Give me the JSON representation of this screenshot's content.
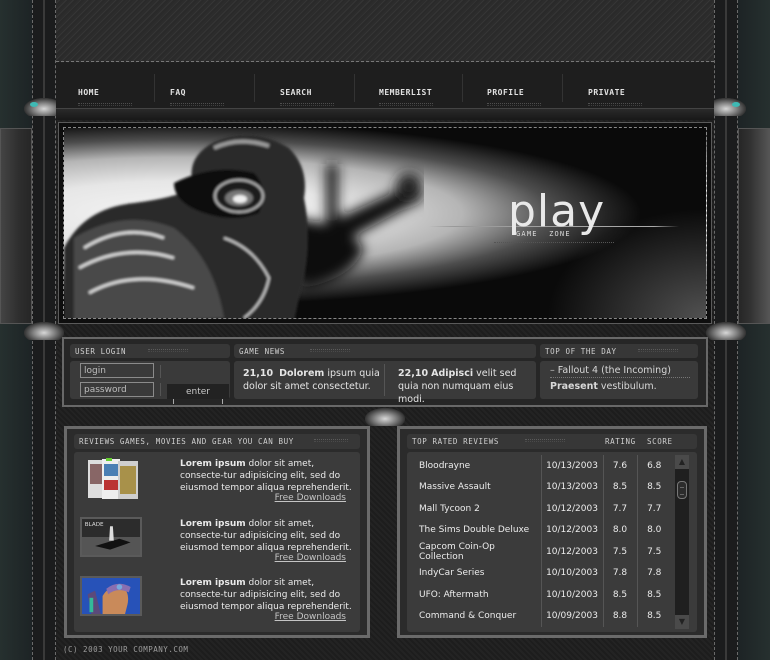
{
  "nav": {
    "items": [
      {
        "label": "Home"
      },
      {
        "label": "FAQ"
      },
      {
        "label": "Search"
      },
      {
        "label": "Memberlist"
      },
      {
        "label": "Profile"
      },
      {
        "label": "Private"
      }
    ]
  },
  "banner": {
    "title": "play",
    "subtitle": "GAME ZONE"
  },
  "login": {
    "heading": "User Login",
    "login_placeholder": "login",
    "password_placeholder": "password",
    "enter_label": "enter"
  },
  "news": {
    "heading": "Game News",
    "items": [
      {
        "date": "21,10",
        "bold": "Dolorem",
        "text": " ipsum quia dolor sit amet consectetur."
      },
      {
        "date": "22,10",
        "bold": "Adipisci",
        "text": " velit sed quia non numquam eius modi."
      }
    ]
  },
  "top_of_day": {
    "heading": "Top of the Day",
    "link": "Fallout 4  (the Incoming)",
    "bold": "Praesent",
    "text": " vestibulum."
  },
  "reviews": {
    "heading": "Reviews games, movies and gear you can buy",
    "items": [
      {
        "image": "game-boxes-thumbnail",
        "bold": "Lorem ipsum",
        "text": " dolor sit amet, consecte-tur adipisicing elit, sed do eiusmod tempor aliqua reprehenderit.",
        "link": "Free Downloads"
      },
      {
        "image": "blade-movie-thumbnail",
        "bold": "Lorem ipsum",
        "text": " dolor sit amet, consecte-tur adipisicing elit, sed do eiusmod tempor aliqua reprehenderit.",
        "link": "Free Downloads"
      },
      {
        "image": "comic-hero-thumbnail",
        "bold": "Lorem ipsum",
        "text": " dolor sit amet, consecte-tur adipisicing elit, sed do eiusmod tempor aliqua reprehenderit.",
        "link": "Free Downloads"
      }
    ]
  },
  "top_rated": {
    "heading": "Top Rated Reviews",
    "col_rating": "Rating",
    "col_score": "Score",
    "rows": [
      {
        "title": "Bloodrayne",
        "date": "10/13/2003",
        "rating": "7.6",
        "score": "6.8"
      },
      {
        "title": "Massive Assault",
        "date": "10/13/2003",
        "rating": "8.5",
        "score": "8.5"
      },
      {
        "title": "Mall Tycoon 2",
        "date": "10/12/2003",
        "rating": "7.7",
        "score": "7.7"
      },
      {
        "title": "The Sims Double Deluxe",
        "date": "10/12/2003",
        "rating": "8.0",
        "score": "8.0"
      },
      {
        "title": "Capcom Coin-Op Collection",
        "date": "10/12/2003",
        "rating": "7.5",
        "score": "7.5"
      },
      {
        "title": "IndyCar Series",
        "date": "10/10/2003",
        "rating": "7.8",
        "score": "7.8"
      },
      {
        "title": "UFO: Aftermath",
        "date": "10/10/2003",
        "rating": "8.5",
        "score": "8.5"
      },
      {
        "title": "Command & Conquer",
        "date": "10/09/2003",
        "rating": "8.8",
        "score": "8.5"
      }
    ],
    "scroll_up": "▲",
    "scroll_down": "▼"
  },
  "footer": {
    "copyright": "(C) 2003 YOUR COMPANY.COM"
  },
  "colors": {
    "accent_teal": "#3fb9b4",
    "panel_bg": "#3b3b3b",
    "frame_border": "#6a6a6a"
  }
}
